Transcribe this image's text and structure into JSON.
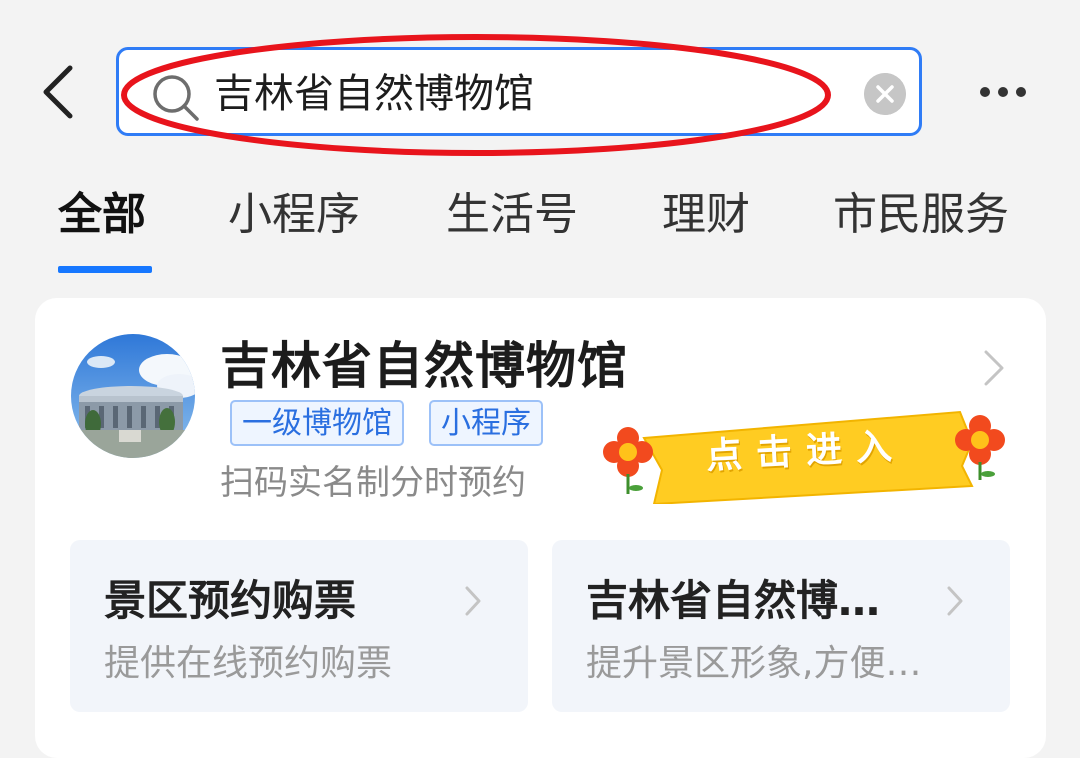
{
  "search": {
    "query": "吉林省自然博物馆"
  },
  "tabs": [
    {
      "label": "全部",
      "active": true
    },
    {
      "label": "小程序",
      "active": false
    },
    {
      "label": "生活号",
      "active": false
    },
    {
      "label": "理财",
      "active": false
    },
    {
      "label": "市民服务",
      "active": false
    }
  ],
  "result": {
    "title": "吉林省自然博物馆",
    "tags": [
      "一级博物馆",
      "小程序"
    ],
    "description": "扫码实名制分时预约",
    "enter_label": "点击进入"
  },
  "services": [
    {
      "title": "景区预约购票",
      "description": "提供在线预约购票"
    },
    {
      "title": "吉林省自然博…",
      "description": "提升景区形象,方便…"
    }
  ],
  "icons": {
    "back": "chevron-left-icon",
    "search": "search-icon",
    "clear": "clear-icon",
    "more": "more-icon",
    "arrow": "chevron-right-icon",
    "flower": "flower-icon"
  },
  "colors": {
    "accent": "#1677ff",
    "search_border": "#2f7cf6",
    "annotation": "#e8141c",
    "ribbon": "#ffcc22",
    "tag_text": "#2a6fe0"
  }
}
